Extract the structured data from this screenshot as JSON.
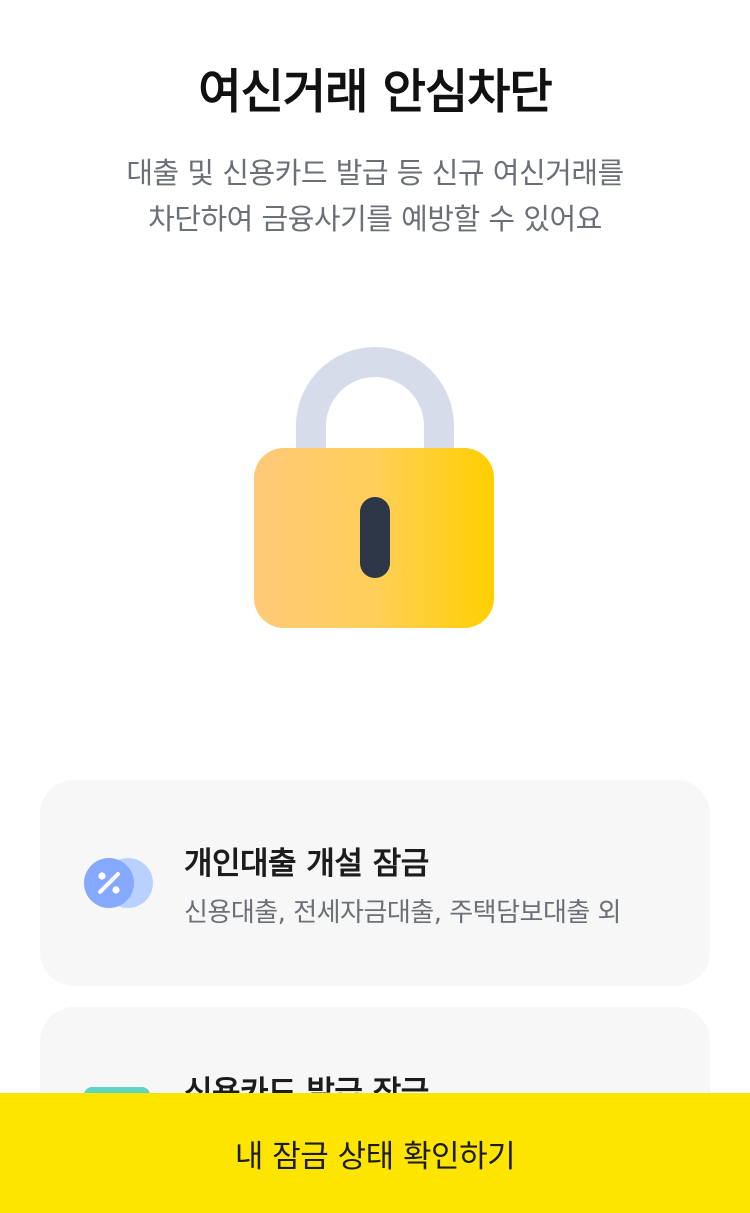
{
  "header": {
    "title": "여신거래 안심차단",
    "subtitle_lines": [
      "대출 및 신용카드 발급 등 신규 여신거래를",
      "차단하여 금융사기를 예방할 수 있어요"
    ]
  },
  "illustration": {
    "icon": "padlock-icon",
    "colors": {
      "shackle": "#d6dcea",
      "body_start": "#ffc978",
      "body_end": "#ffcf00",
      "keyhole": "#2d3748"
    }
  },
  "cards": [
    {
      "title": "개인대출 개설 잠금",
      "description": "신용대출, 전세자금대출, 주택담보대출 외",
      "icon": "percent-coin-icon"
    },
    {
      "title": "신용카드 발급 잠금",
      "icon": "credit-card-icon"
    }
  ],
  "cta": {
    "label": "내 잠금 상태 확인하기",
    "color": "#fee500"
  },
  "colors": {
    "background": "#ffffff",
    "card_background": "#f7f7f7",
    "title_text": "#111111",
    "secondary_text": "#6b6f76"
  }
}
